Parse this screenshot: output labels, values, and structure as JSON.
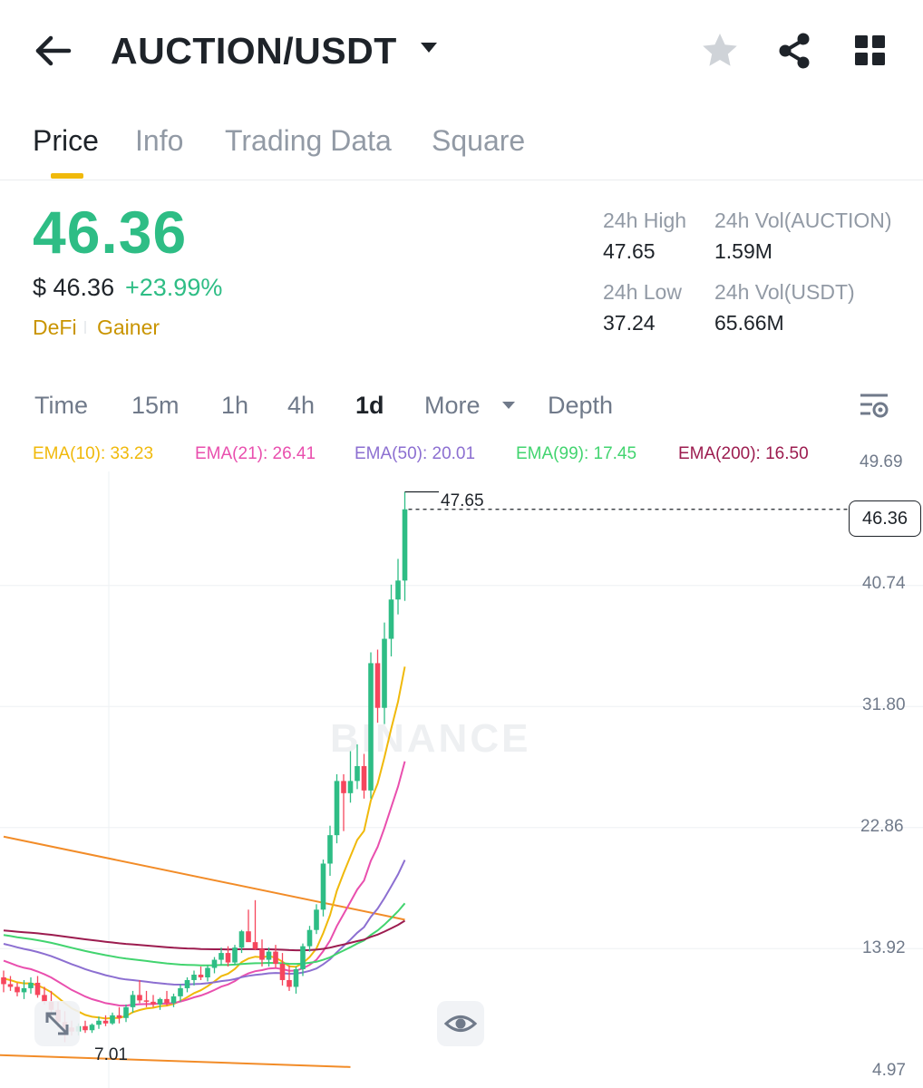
{
  "header": {
    "pair": "AUCTION/USDT"
  },
  "icons": {
    "back": "arrow-left-icon",
    "dropdown": "caret-down-icon",
    "favorite": "star-icon",
    "share": "share-icon",
    "apps": "grid-icon",
    "chart_settings": "settings-icon",
    "expand": "expand-icon",
    "visibility": "eye-icon"
  },
  "tabs": [
    {
      "label": "Price",
      "active": true
    },
    {
      "label": "Info",
      "active": false
    },
    {
      "label": "Trading Data",
      "active": false
    },
    {
      "label": "Square",
      "active": false
    }
  ],
  "price": {
    "last": "46.36",
    "usd": "$ 46.36",
    "change": "+23.99%",
    "tags": [
      "DeFi",
      "Gainer"
    ]
  },
  "stats": {
    "high_label": "24h High",
    "high_value": "47.65",
    "low_label": "24h Low",
    "low_value": "37.24",
    "vol_base_label": "24h Vol(AUCTION)",
    "vol_base_value": "1.59M",
    "vol_quote_label": "24h Vol(USDT)",
    "vol_quote_value": "65.66M"
  },
  "intervals": [
    {
      "label": "Time",
      "active": false
    },
    {
      "label": "15m",
      "active": false
    },
    {
      "label": "1h",
      "active": false
    },
    {
      "label": "4h",
      "active": false
    },
    {
      "label": "1d",
      "active": true
    },
    {
      "label": "More",
      "active": false
    },
    {
      "label": "Depth",
      "active": false
    }
  ],
  "ema": [
    {
      "label": "EMA(10): 33.23",
      "color": "#f0b90b"
    },
    {
      "label": "EMA(21): 26.41",
      "color": "#e94fae"
    },
    {
      "label": "EMA(50): 20.01",
      "color": "#8c6fd1"
    },
    {
      "label": "EMA(99): 17.45",
      "color": "#42d46f"
    },
    {
      "label": "EMA(200): 16.50",
      "color": "#9c1c4f"
    }
  ],
  "colors": {
    "up": "#2ebd85",
    "down": "#f6465d",
    "trendline": "#f28c28",
    "accent": "#f0b90b"
  },
  "chart": {
    "y_ticks": [
      "49.69",
      "40.74",
      "31.80",
      "22.86",
      "13.92",
      "4.97"
    ],
    "last_price": "46.36",
    "high_mark": "47.65",
    "low_mark": "7.01",
    "watermark": "BINANCE"
  },
  "chart_data": {
    "type": "candlestick",
    "ylim": [
      4.97,
      49.69
    ],
    "y_ticks": [
      49.69,
      40.74,
      31.8,
      22.86,
      13.92,
      4.97
    ],
    "candles": [
      [
        11.8,
        12.3,
        10.7,
        11.3
      ],
      [
        11.3,
        11.9,
        10.8,
        11.1
      ],
      [
        11.1,
        11.4,
        10.4,
        10.7
      ],
      [
        10.7,
        11.6,
        10.2,
        11.0
      ],
      [
        11.0,
        11.8,
        10.6,
        11.4
      ],
      [
        11.4,
        11.9,
        10.3,
        10.5
      ],
      [
        10.5,
        11.1,
        9.8,
        10.0
      ],
      [
        10.0,
        10.8,
        9.0,
        9.4
      ],
      [
        9.4,
        10.0,
        8.1,
        8.5
      ],
      [
        8.5,
        9.3,
        7.01,
        8.1
      ],
      [
        8.1,
        8.6,
        7.5,
        7.8
      ],
      [
        7.8,
        8.4,
        7.5,
        8.2
      ],
      [
        8.2,
        8.6,
        7.7,
        7.9
      ],
      [
        7.9,
        8.4,
        7.7,
        8.3
      ],
      [
        8.3,
        8.9,
        8.0,
        8.6
      ],
      [
        8.6,
        9.0,
        8.2,
        8.4
      ],
      [
        8.4,
        9.2,
        8.3,
        9.0
      ],
      [
        9.0,
        9.6,
        8.4,
        8.8
      ],
      [
        8.8,
        9.8,
        8.5,
        9.6
      ],
      [
        9.6,
        10.8,
        9.2,
        10.5
      ],
      [
        10.5,
        11.6,
        9.9,
        10.1
      ],
      [
        10.1,
        10.8,
        9.6,
        10.0
      ],
      [
        10.0,
        10.5,
        9.6,
        9.8
      ],
      [
        9.8,
        10.3,
        9.4,
        10.2
      ],
      [
        10.2,
        10.8,
        9.7,
        9.9
      ],
      [
        9.9,
        10.6,
        9.6,
        10.4
      ],
      [
        10.4,
        11.3,
        10.0,
        11.0
      ],
      [
        11.0,
        11.8,
        10.7,
        11.6
      ],
      [
        11.6,
        12.3,
        11.2,
        12.0
      ],
      [
        12.0,
        12.6,
        11.6,
        11.8
      ],
      [
        11.8,
        12.7,
        11.5,
        12.5
      ],
      [
        12.5,
        13.3,
        12.1,
        13.1
      ],
      [
        13.1,
        14.0,
        12.7,
        13.6
      ],
      [
        13.6,
        14.1,
        12.6,
        12.9
      ],
      [
        12.9,
        14.2,
        12.7,
        14.0
      ],
      [
        14.0,
        15.3,
        13.6,
        15.2
      ],
      [
        15.2,
        16.8,
        14.7,
        14.4
      ],
      [
        14.4,
        17.5,
        13.8,
        13.9
      ],
      [
        13.9,
        14.6,
        12.6,
        13.1
      ],
      [
        13.1,
        14.0,
        12.6,
        13.7
      ],
      [
        13.7,
        14.2,
        12.5,
        12.8
      ],
      [
        12.8,
        13.6,
        11.2,
        11.6
      ],
      [
        11.6,
        12.7,
        10.8,
        11.1
      ],
      [
        11.1,
        12.6,
        10.6,
        12.4
      ],
      [
        12.4,
        14.3,
        11.9,
        14.1
      ],
      [
        14.1,
        15.6,
        13.7,
        15.3
      ],
      [
        15.3,
        17.2,
        15.0,
        16.8
      ],
      [
        16.8,
        20.5,
        16.3,
        20.2
      ],
      [
        20.2,
        23.0,
        19.3,
        22.3
      ],
      [
        22.3,
        26.8,
        21.7,
        26.3
      ],
      [
        26.3,
        26.8,
        22.6,
        25.4
      ],
      [
        25.4,
        28.5,
        24.7,
        26.3
      ],
      [
        26.3,
        29.0,
        25.7,
        27.4
      ],
      [
        27.4,
        28.3,
        25.0,
        25.6
      ],
      [
        25.6,
        35.8,
        25.0,
        35.0
      ],
      [
        35.0,
        36.0,
        30.6,
        31.7
      ],
      [
        31.7,
        38.0,
        30.5,
        36.8
      ],
      [
        36.8,
        40.8,
        35.5,
        39.7
      ],
      [
        39.7,
        42.7,
        38.6,
        41.1
      ],
      [
        41.1,
        47.65,
        39.6,
        46.36
      ]
    ],
    "trendlines": [
      {
        "name": "upper",
        "from": [
          0,
          22.19
        ],
        "to": [
          59,
          16.06
        ]
      },
      {
        "name": "lower",
        "from": [
          -1,
          6.07
        ],
        "to": [
          51,
          5.18
        ]
      }
    ]
  }
}
